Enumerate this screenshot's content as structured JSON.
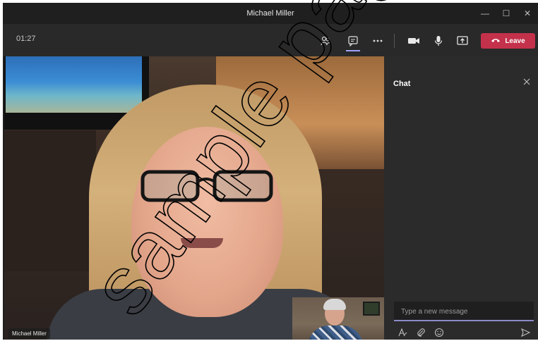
{
  "window": {
    "title": "Michael Miller",
    "controls": {
      "minimize": "—",
      "maximize": "☐",
      "close": "✕"
    }
  },
  "toolbar": {
    "timer": "01:27",
    "icons": [
      "participants-icon",
      "chat-icon",
      "more-options-icon",
      "camera-icon",
      "microphone-icon",
      "share-screen-icon"
    ],
    "leave_label": "Leave"
  },
  "video": {
    "main_name": "Michael Miller"
  },
  "chat": {
    "title": "Chat",
    "input_placeholder": "Type a new message"
  },
  "watermark": {
    "text": "sample pages"
  },
  "colors": {
    "leave": "#c4314b",
    "accent": "#9ea2ff",
    "panel": "#2b2b2b",
    "toolbar": "#292929"
  }
}
